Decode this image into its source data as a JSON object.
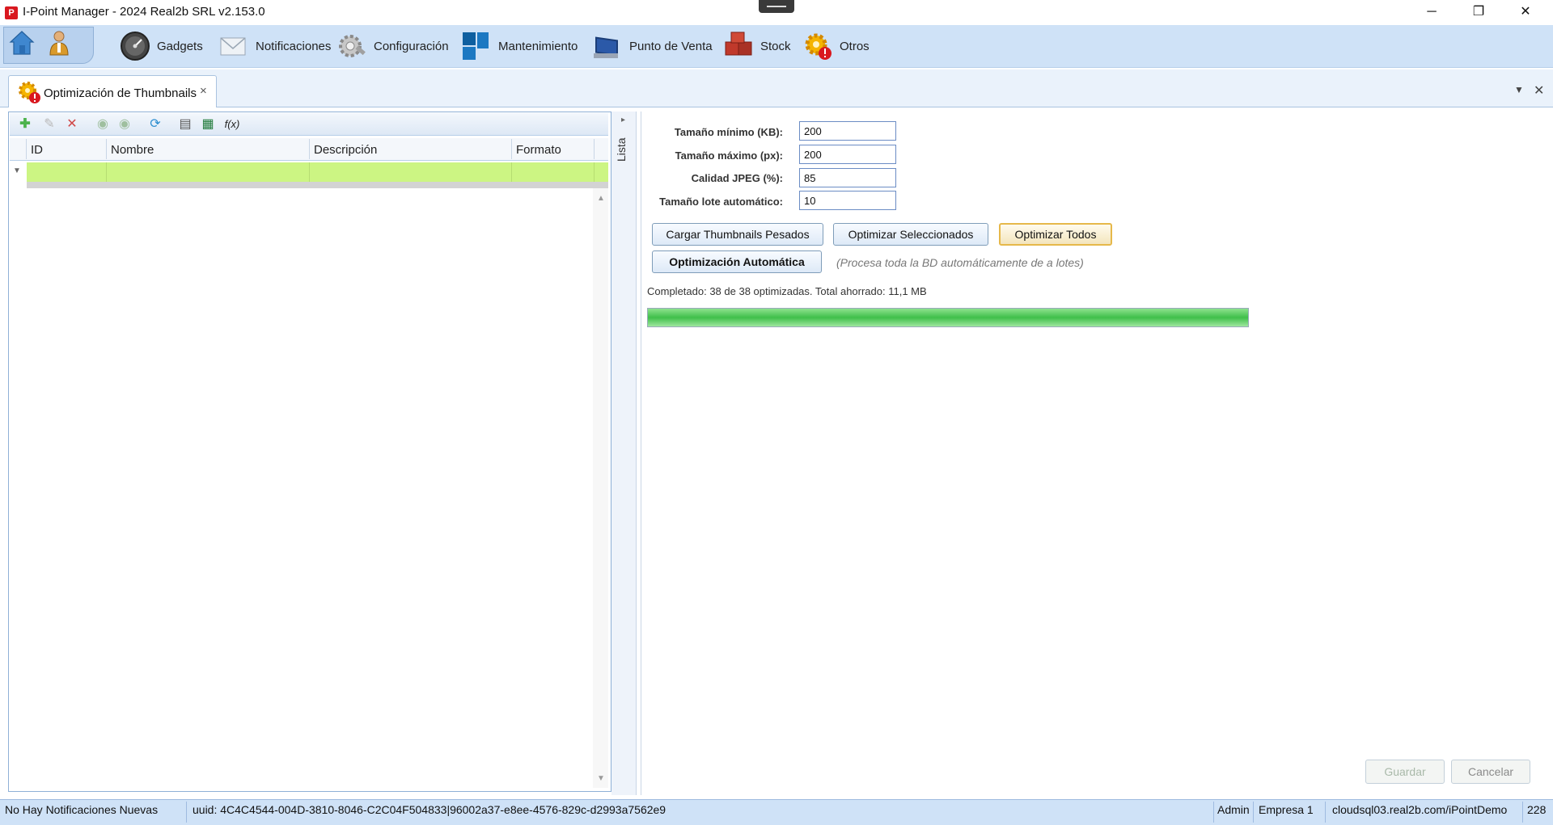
{
  "window": {
    "title": "I-Point Manager - 2024 Real2b SRL v2.153.0",
    "logo_letter": "P",
    "minimize": "─",
    "restore": "❐",
    "close": "✕"
  },
  "ribbon": {
    "items": [
      {
        "label": "Gadgets",
        "icon": "speedometer-icon"
      },
      {
        "label": "Notificaciones",
        "icon": "envelope-icon"
      },
      {
        "label": "Configuración",
        "icon": "gear-wrench-icon"
      },
      {
        "label": "Mantenimiento",
        "icon": "tiles-icon"
      },
      {
        "label": "Punto de Venta",
        "icon": "pos-monitor-icon"
      },
      {
        "label": "Stock",
        "icon": "boxes-icon"
      },
      {
        "label": "Otros",
        "icon": "gear-alert-icon"
      }
    ]
  },
  "tabs": {
    "active_label": "Optimización de Thumbnails",
    "close_glyph": "×",
    "menu_glyph": "▼",
    "close_all_glyph": "✕"
  },
  "grid": {
    "columns": [
      "ID",
      "Nombre",
      "Descripción",
      "Formato"
    ],
    "rows": [],
    "toolbar": [
      "add-icon",
      "edit-icon",
      "delete-icon",
      "prev-icon",
      "next-icon",
      "refresh-icon",
      "export-doc-icon",
      "export-excel-icon",
      "formula-icon"
    ]
  },
  "side_panel": {
    "label": "Lista",
    "arrow": "▸"
  },
  "form": {
    "fields": [
      {
        "label": "Tamaño mínimo (KB):",
        "value": "200"
      },
      {
        "label": "Tamaño máximo (px):",
        "value": "200"
      },
      {
        "label": "Calidad JPEG (%):",
        "value": "85"
      },
      {
        "label": "Tamaño lote automático:",
        "value": "10"
      }
    ],
    "buttons": {
      "load": "Cargar Thumbnails Pesados",
      "optimize_selected": "Optimizar Seleccionados",
      "optimize_all": "Optimizar Todos",
      "auto": "Optimización Automática"
    },
    "auto_hint": "(Procesa toda la BD automáticamente de a lotes)",
    "status": "Completado: 38 de 38 optimizadas. Total ahorrado: 11,1 MB",
    "progress_percent": 100,
    "save": "Guardar",
    "cancel": "Cancelar"
  },
  "statusbar": {
    "notifications": "No Hay Notificaciones Nuevas",
    "uuid": "uuid: 4C4C4544-004D-3810-8046-C2C04F504833|96002a37-e8ee-4576-829c-d2993a7562e9",
    "user": "Admin",
    "company": "Empresa 1",
    "server": "cloudsql03.real2b.com/iPointDemo",
    "extra": "228"
  },
  "colors": {
    "ribbon_bg": "#cfe2f7",
    "filter_row": "#ccf583",
    "progress_fill": "#3fbf4a",
    "accent_border": "#e6b84a"
  }
}
